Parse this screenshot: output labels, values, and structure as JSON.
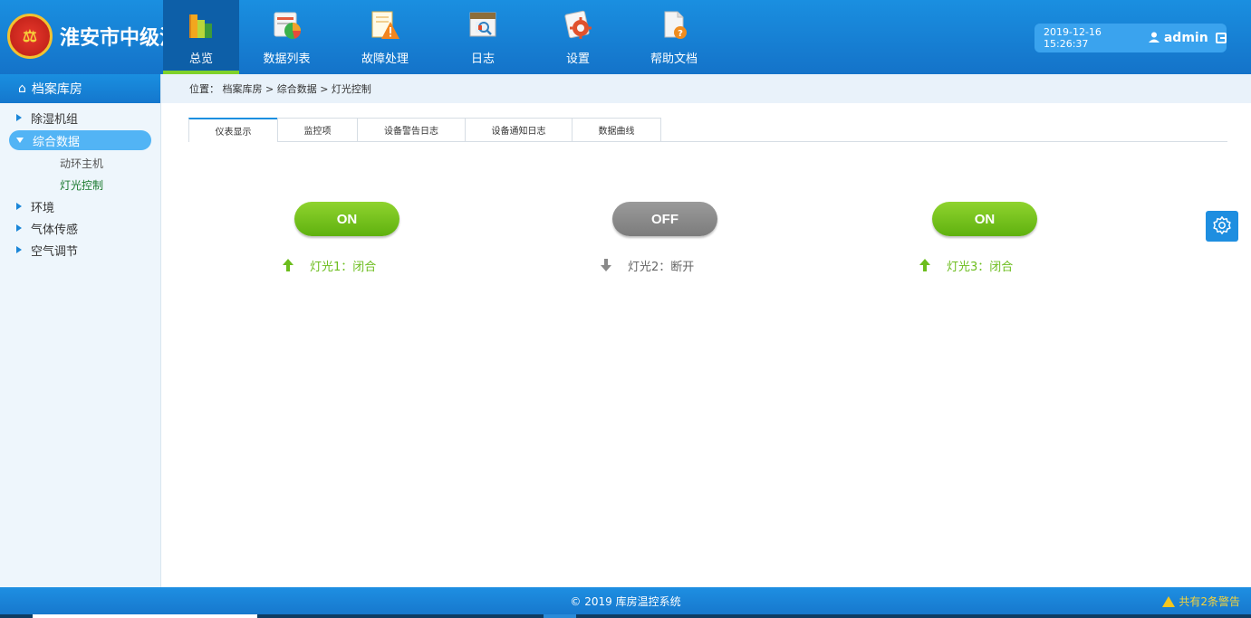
{
  "header": {
    "logo_text": "淮安市中级法院",
    "emblem_icon": "court-emblem",
    "nav": [
      {
        "label": "总览",
        "icon": "overview-books-icon"
      },
      {
        "label": "数据列表",
        "icon": "data-list-chart-icon"
      },
      {
        "label": "故障处理",
        "icon": "fault-warning-icon"
      },
      {
        "label": "日志",
        "icon": "log-calendar-icon"
      },
      {
        "label": "设置",
        "icon": "settings-gear-icon"
      },
      {
        "label": "帮助文档",
        "icon": "help-document-icon"
      }
    ],
    "active_nav": "总览",
    "datetime": "2019-12-16 15:26:37",
    "username": "admin"
  },
  "sidebar": {
    "title": "档案库房",
    "items": [
      {
        "label": "除湿机组"
      },
      {
        "label": "综合数据",
        "children": [
          "动环主机",
          "灯光控制"
        ]
      },
      {
        "label": "环境"
      },
      {
        "label": "气体传感"
      },
      {
        "label": "空气调节"
      }
    ],
    "current": "灯光控制"
  },
  "breadcrumb": "位置： 档案库房 > 综合数据 > 灯光控制",
  "tabs": [
    "仪表显示",
    "监控项",
    "设备警告日志",
    "设备通知日志",
    "数据曲线"
  ],
  "active_tab": "仪表显示",
  "lights": [
    {
      "switch_label": "ON",
      "state": "on",
      "status_text": "灯光1：闭合"
    },
    {
      "switch_label": "OFF",
      "state": "off",
      "status_text": "灯光2：断开"
    },
    {
      "switch_label": "ON",
      "state": "on",
      "status_text": "灯光3：闭合"
    }
  ],
  "footer": {
    "copyright": "© 2019  库房温控系统",
    "alarm_text": "共有2条警告"
  },
  "colors": {
    "primary": "#1a8fe0",
    "on_green": "#6cbd1d",
    "off_gray": "#8a8a8a",
    "alarm_yellow": "#f5d33b"
  }
}
